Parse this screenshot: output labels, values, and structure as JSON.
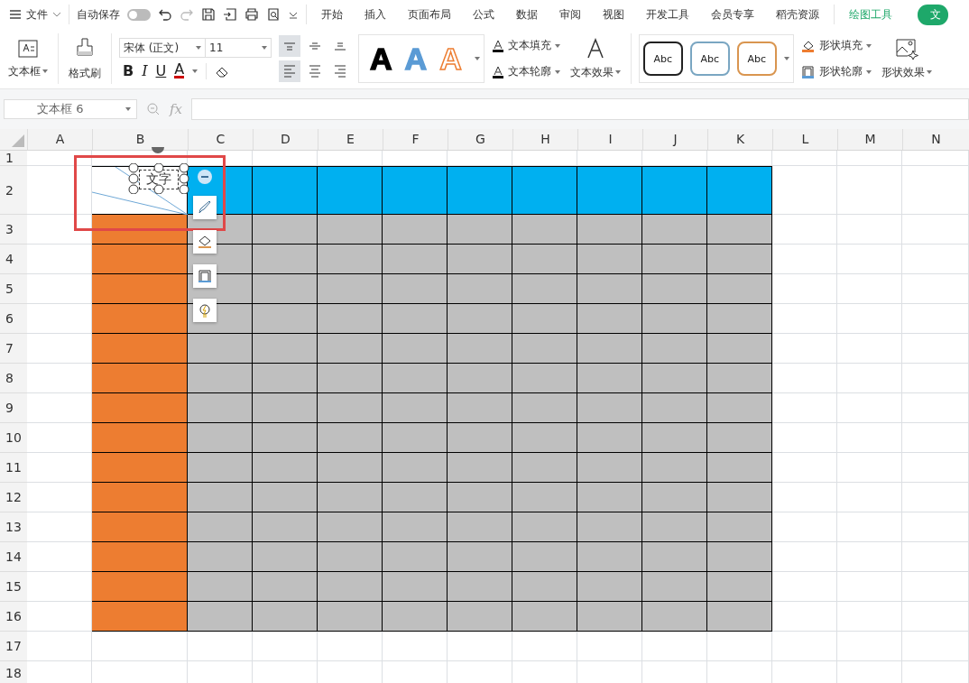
{
  "menu": {
    "file_label": "文件",
    "autosave_label": "自动保存",
    "autosave_on": false,
    "tabs": [
      {
        "label": "开始",
        "selected": false,
        "contextual": false
      },
      {
        "label": "插入",
        "selected": false,
        "contextual": false
      },
      {
        "label": "页面布局",
        "selected": false,
        "contextual": false
      },
      {
        "label": "公式",
        "selected": false,
        "contextual": false
      },
      {
        "label": "数据",
        "selected": false,
        "contextual": false
      },
      {
        "label": "审阅",
        "selected": false,
        "contextual": false
      },
      {
        "label": "视图",
        "selected": false,
        "contextual": false
      },
      {
        "label": "开发工具",
        "selected": false,
        "contextual": false
      },
      {
        "label": "会员专享",
        "selected": false,
        "contextual": false
      },
      {
        "label": "稻壳资源",
        "selected": false,
        "contextual": false
      },
      {
        "label": "绘图工具",
        "selected": false,
        "contextual": true
      },
      {
        "label": "文",
        "selected": true,
        "contextual": true
      }
    ]
  },
  "ribbon": {
    "text_box_label": "文本框",
    "format_painter_label": "格式刷",
    "font": "宋体 (正文)",
    "size": "11",
    "bold": "B",
    "italic": "I",
    "underline": "U",
    "font_color": "A",
    "alignment": [
      {
        "kind": "top",
        "selected": true
      },
      {
        "kind": "middle",
        "selected": false
      },
      {
        "kind": "bottom",
        "selected": false
      },
      {
        "kind": "left",
        "selected": true
      },
      {
        "kind": "center",
        "selected": false
      },
      {
        "kind": "right",
        "selected": false
      }
    ],
    "text_styles": [
      {
        "label": "A",
        "kind": "black"
      },
      {
        "label": "A",
        "kind": "blue"
      },
      {
        "label": "A",
        "kind": "orange"
      }
    ],
    "text_fill": "文本填充",
    "text_outline": "文本轮廓",
    "text_effect": "文本效果",
    "shape_styles": [
      {
        "label": "Abc",
        "color": "#222222"
      },
      {
        "label": "Abc",
        "color": "#7aa6c2"
      },
      {
        "label": "Abc",
        "color": "#d9954f"
      }
    ],
    "shape_fill": "形状填充",
    "shape_outline": "形状轮廓",
    "shape_effect": "形状效果"
  },
  "formula_bar": {
    "name_box": "文本框  6",
    "fx": "fx"
  },
  "sheet": {
    "columns": [
      "A",
      "B",
      "C",
      "D",
      "E",
      "F",
      "G",
      "H",
      "I",
      "J",
      "K",
      "L",
      "M",
      "N"
    ],
    "rows": [
      "1",
      "2",
      "3",
      "4",
      "5",
      "6",
      "7",
      "8",
      "9",
      "10",
      "11",
      "12",
      "13",
      "14",
      "15",
      "16",
      "17",
      "18"
    ],
    "fills": [
      {
        "kind": "header-row",
        "color": "#00b0f0"
      },
      {
        "kind": "header-column",
        "color": "#ed7d31"
      },
      {
        "kind": "body",
        "color": "#bfbfbf"
      }
    ],
    "text_box": "文字"
  }
}
